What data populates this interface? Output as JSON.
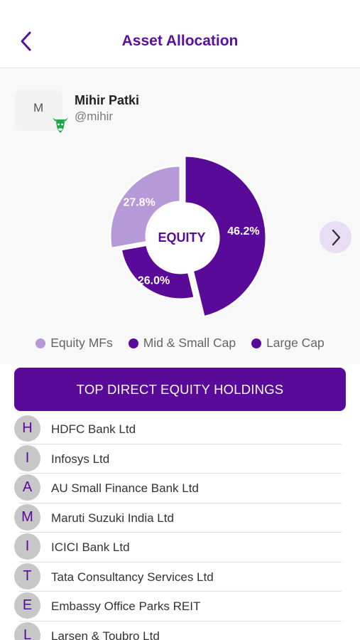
{
  "header": {
    "title": "Asset Allocation",
    "back_icon": "chevron-left-icon"
  },
  "user": {
    "avatar_letter": "M",
    "name": "Mihir Patki",
    "handle": "@mihir",
    "badge_icon": "bull-icon"
  },
  "chart_data": {
    "type": "pie",
    "center_label": "EQUITY",
    "slices": [
      {
        "name": "Large Cap",
        "value": 46.2,
        "label": "46.2%",
        "color": "#5a0a99"
      },
      {
        "name": "Mid & Small Cap",
        "value": 26.0,
        "label": "26.0%",
        "color": "#5a0a99"
      },
      {
        "name": "Equity MFs",
        "value": 27.8,
        "label": "27.8%",
        "color": "#b59ad7"
      }
    ],
    "legend": [
      "Equity MFs",
      "Mid & Small Cap",
      "Large Cap"
    ],
    "legend_placement": "bottom"
  },
  "legend_colors": [
    "#b59ad7",
    "#5a0a99",
    "#5a0a99"
  ],
  "next_icon": "chevron-right-icon",
  "holdings": {
    "button_label": "TOP DIRECT EQUITY HOLDINGS",
    "items": [
      {
        "letter": "H",
        "name": "HDFC Bank Ltd"
      },
      {
        "letter": "I",
        "name": "Infosys Ltd"
      },
      {
        "letter": "A",
        "name": "AU Small Finance Bank Ltd"
      },
      {
        "letter": "M",
        "name": "Maruti Suzuki India Ltd"
      },
      {
        "letter": "I",
        "name": "ICICI Bank Ltd"
      },
      {
        "letter": "T",
        "name": "Tata Consultancy Services Ltd"
      },
      {
        "letter": "E",
        "name": "Embassy Office Parks REIT"
      },
      {
        "letter": "L",
        "name": "Larsen & Toubro Ltd"
      }
    ]
  },
  "colors": {
    "brand": "#5a0a99",
    "brand_light": "#b59ad7",
    "next_bg": "#e8ddf3",
    "section_bg": "#f8f8f8"
  }
}
